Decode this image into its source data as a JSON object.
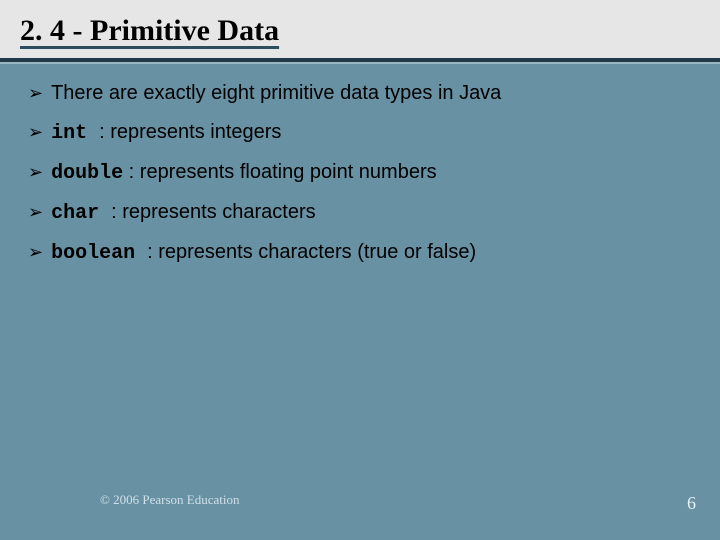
{
  "header": {
    "title": "2. 4 - Primitive Data"
  },
  "bullets": [
    {
      "code": "",
      "desc": "There are exactly eight primitive data types in Java"
    },
    {
      "code": "int ",
      "desc": " : represents integers"
    },
    {
      "code": "double",
      "desc": " : represents floating point numbers"
    },
    {
      "code": "char ",
      "desc": " : represents characters"
    },
    {
      "code": "boolean ",
      "desc": " : represents characters (true or false)"
    }
  ],
  "footer": {
    "copyright": "© 2006 Pearson Education",
    "page_number": "6"
  }
}
